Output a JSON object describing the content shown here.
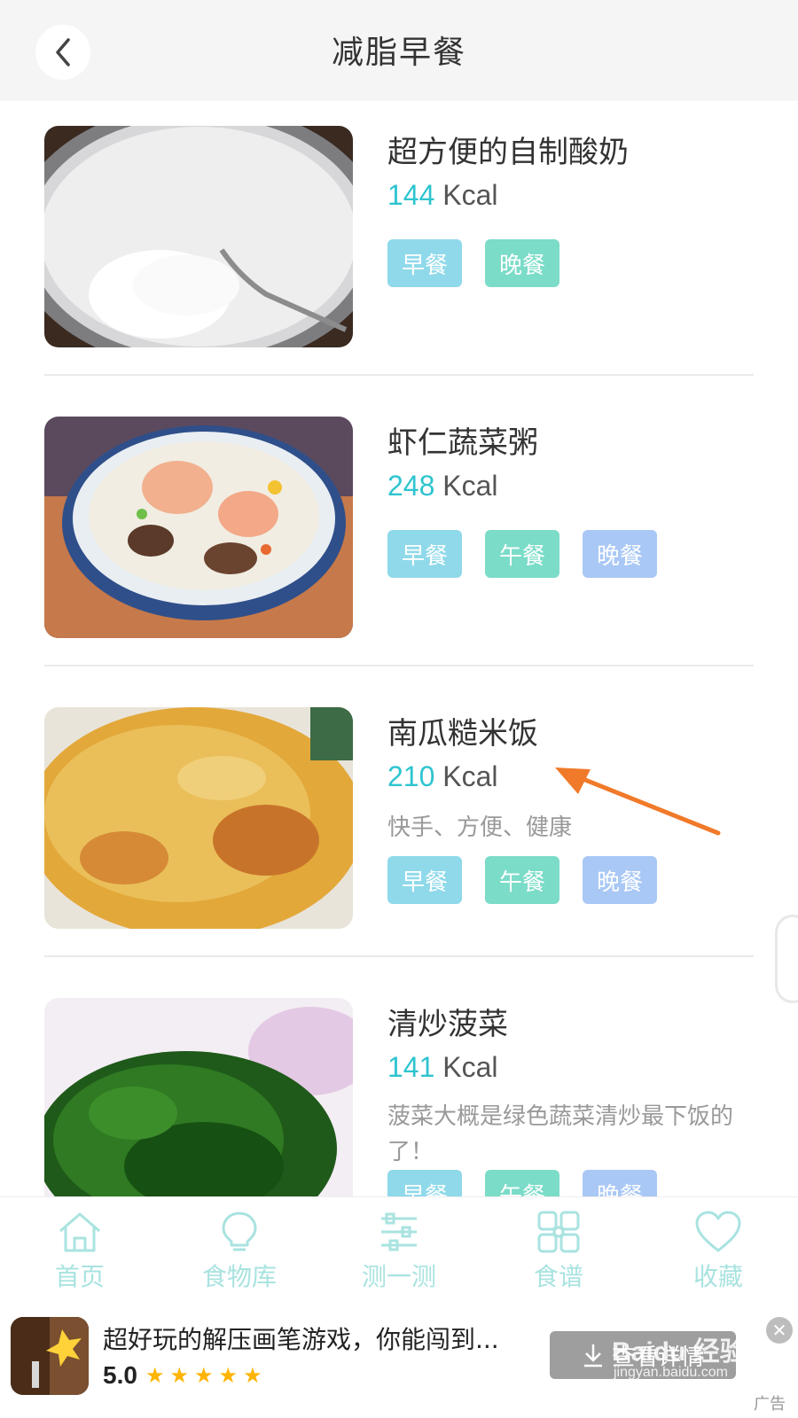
{
  "header": {
    "title": "减脂早餐",
    "back_icon": "chevron-left-icon"
  },
  "items": [
    {
      "title": "超方便的自制酸奶",
      "kcal_value": "144",
      "kcal_unit": "Kcal",
      "desc": "",
      "tags": [
        "早餐",
        "晚餐"
      ]
    },
    {
      "title": "虾仁蔬菜粥",
      "kcal_value": "248",
      "kcal_unit": "Kcal",
      "desc": "",
      "tags": [
        "早餐",
        "午餐",
        "晚餐"
      ]
    },
    {
      "title": "南瓜糙米饭",
      "kcal_value": "210",
      "kcal_unit": "Kcal",
      "desc": "快手、方便、健康",
      "tags": [
        "早餐",
        "午餐",
        "晚餐"
      ]
    },
    {
      "title": "清炒菠菜",
      "kcal_value": "141",
      "kcal_unit": "Kcal",
      "desc": "菠菜大概是绿色蔬菜清炒最下饭的了！",
      "tags": [
        "早餐",
        "午餐",
        "晚餐"
      ]
    }
  ],
  "tabbar": {
    "tabs": [
      {
        "label": "首页",
        "icon": "home-icon"
      },
      {
        "label": "食物库",
        "icon": "lightbulb-icon"
      },
      {
        "label": "测一测",
        "icon": "sliders-icon"
      },
      {
        "label": "食谱",
        "icon": "grid-icon"
      },
      {
        "label": "收藏",
        "icon": "heart-icon"
      }
    ]
  },
  "ad": {
    "title": "超好玩的解压画笔游戏，你能闯到...",
    "rating": "5.0",
    "stars": "★★★★★",
    "button_label": "查看详情",
    "close": "✕",
    "label": "广告"
  },
  "watermark": {
    "text": "Baidu 经验",
    "sub": "jingyan.baidu.com"
  },
  "colors": {
    "accent": "#2ec4cf",
    "tag_breakfast": "#8fd9ea",
    "tag_lunch": "#7bdcc8",
    "tag_dinner": "#a9c8f5",
    "annotation_arrow": "#f07a2a"
  }
}
